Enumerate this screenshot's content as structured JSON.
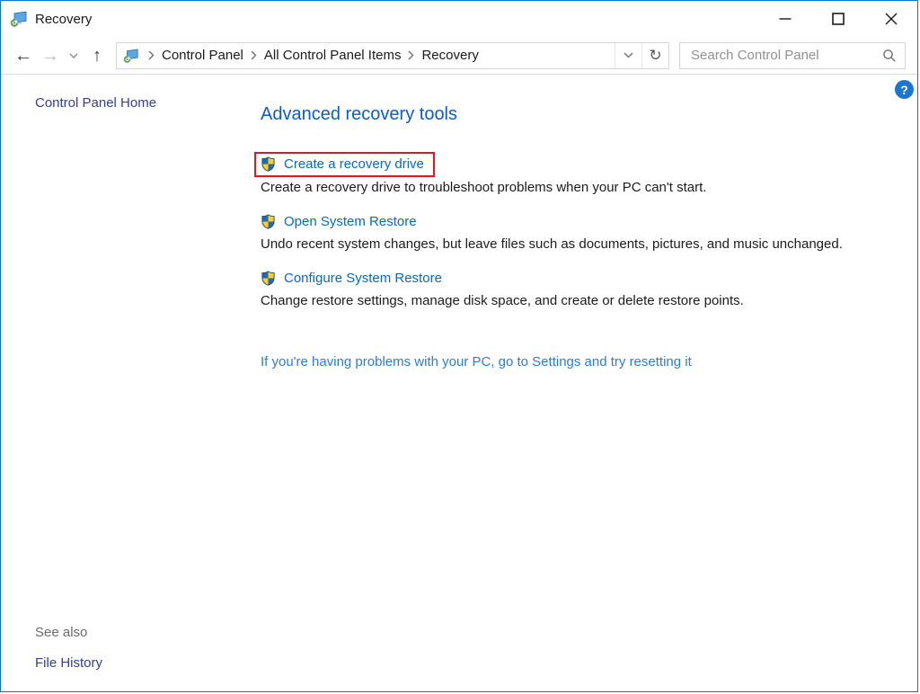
{
  "window": {
    "title": "Recovery"
  },
  "navbar": {
    "back_glyph": "←",
    "forward_glyph": "→",
    "up_glyph": "↑",
    "refresh_glyph": "↻",
    "breadcrumb": [
      "Control Panel",
      "All Control Panel Items",
      "Recovery"
    ],
    "search_placeholder": "Search Control Panel"
  },
  "sidebar": {
    "home_label": "Control Panel Home",
    "see_also": "See also",
    "file_history": "File History"
  },
  "main": {
    "heading": "Advanced recovery tools",
    "help_glyph": "?",
    "tasks": [
      {
        "label": "Create a recovery drive",
        "description": "Create a recovery drive to troubleshoot problems when your PC can't start.",
        "highlighted": true
      },
      {
        "label": "Open System Restore",
        "description": "Undo recent system changes, but leave files such as documents, pictures, and music unchanged.",
        "highlighted": false
      },
      {
        "label": "Configure System Restore",
        "description": "Change restore settings, manage disk space, and create or delete restore points.",
        "highlighted": false
      }
    ],
    "footer_link": "If you're having problems with your PC, go to Settings and try resetting it"
  },
  "colors": {
    "window_border": "#0078D7",
    "heading_blue": "#0A5DC6",
    "task_link_blue": "#0667CC",
    "footer_link_blue": "#2B7CD9",
    "sidebar_link_navy": "#31409A",
    "highlight_red": "#E8151B",
    "shield_blue": "#2468B4",
    "shield_yellow": "#FCCE1F"
  }
}
